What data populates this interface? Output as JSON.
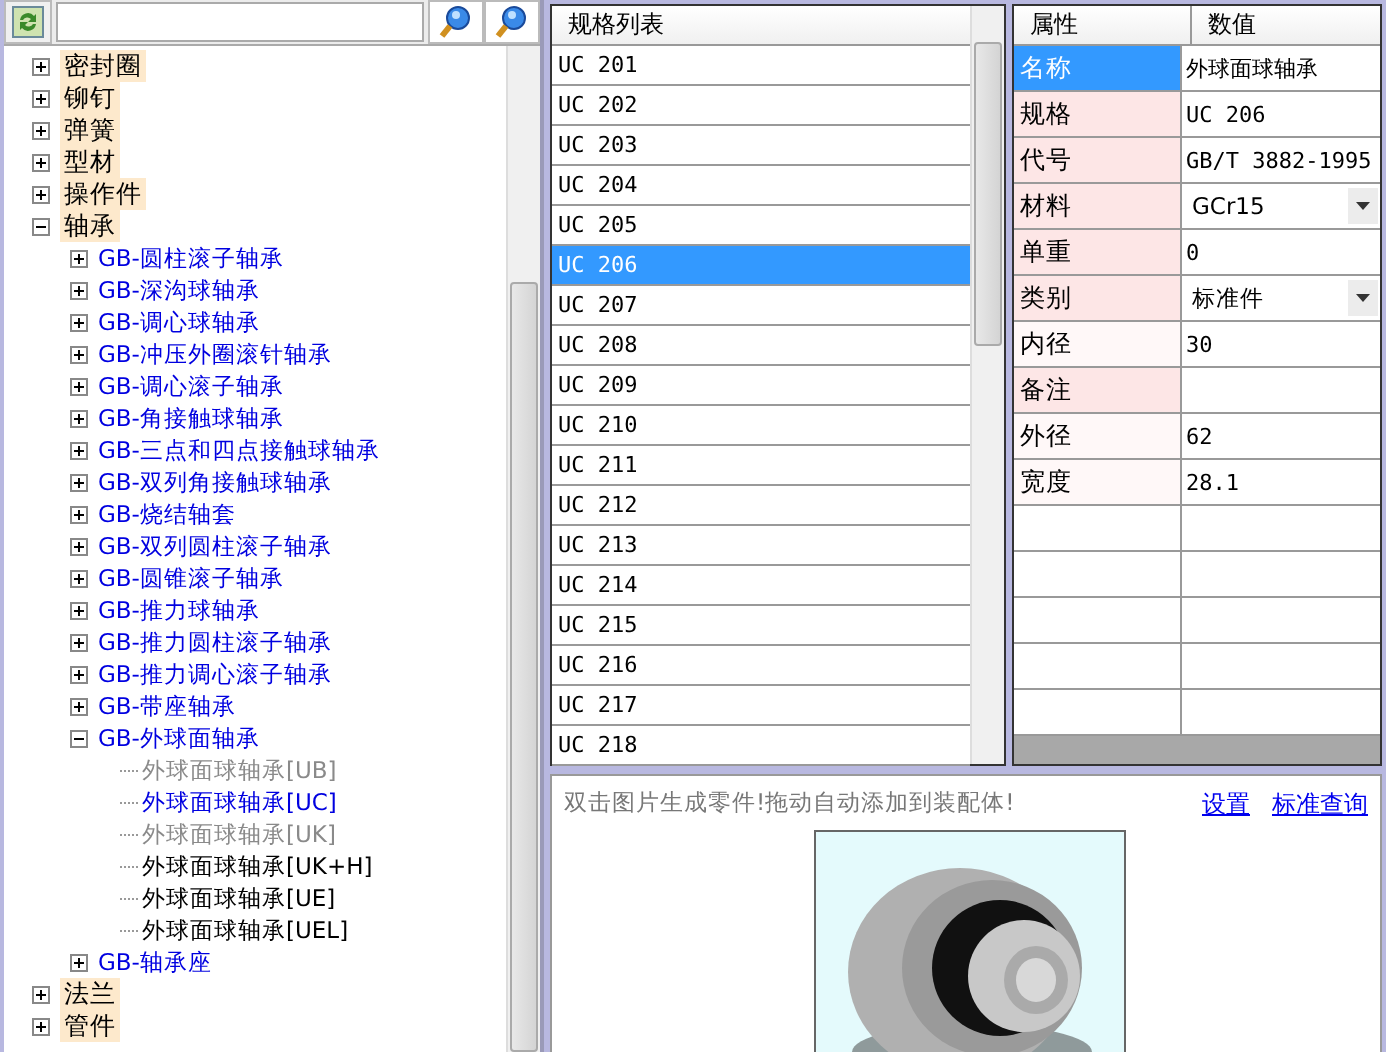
{
  "tree": [
    {
      "label": "密封圈",
      "expanded": false
    },
    {
      "label": "铆钉",
      "expanded": false
    },
    {
      "label": "弹簧",
      "expanded": false
    },
    {
      "label": "型材",
      "expanded": false
    },
    {
      "label": "操作件",
      "expanded": false
    },
    {
      "label": "轴承",
      "expanded": true,
      "children": [
        {
          "label": "GB-圆柱滚子轴承",
          "expanded": false
        },
        {
          "label": "GB-深沟球轴承",
          "expanded": false
        },
        {
          "label": "GB-调心球轴承",
          "expanded": false
        },
        {
          "label": "GB-冲压外圈滚针轴承",
          "expanded": false
        },
        {
          "label": "GB-调心滚子轴承",
          "expanded": false
        },
        {
          "label": "GB-角接触球轴承",
          "expanded": false
        },
        {
          "label": "GB-三点和四点接触球轴承",
          "expanded": false
        },
        {
          "label": "GB-双列角接触球轴承",
          "expanded": false
        },
        {
          "label": "GB-烧结轴套",
          "expanded": false
        },
        {
          "label": "GB-双列圆柱滚子轴承",
          "expanded": false
        },
        {
          "label": "GB-圆锥滚子轴承",
          "expanded": false
        },
        {
          "label": "GB-推力球轴承",
          "expanded": false
        },
        {
          "label": "GB-推力圆柱滚子轴承",
          "expanded": false
        },
        {
          "label": "GB-推力调心滚子轴承",
          "expanded": false
        },
        {
          "label": "GB-带座轴承",
          "expanded": false
        },
        {
          "label": "GB-外球面轴承",
          "expanded": true,
          "children": [
            {
              "label": "外球面球轴承[UB]",
              "disabled": true,
              "selected": false
            },
            {
              "label": "外球面球轴承[UC]",
              "disabled": false,
              "selected": true
            },
            {
              "label": "外球面球轴承[UK]",
              "disabled": true,
              "selected": false
            },
            {
              "label": "外球面球轴承[UK+H]",
              "disabled": false,
              "selected": false
            },
            {
              "label": "外球面球轴承[UE]",
              "disabled": false,
              "selected": false
            },
            {
              "label": "外球面球轴承[UEL]",
              "disabled": false,
              "selected": false
            }
          ]
        },
        {
          "label": "GB-轴承座",
          "expanded": false
        }
      ]
    },
    {
      "label": "法兰",
      "expanded": false
    },
    {
      "label": "管件",
      "expanded": false
    }
  ],
  "spec_list": {
    "header": "规格列表",
    "rows": [
      {
        "label": "UC 201",
        "selected": false
      },
      {
        "label": "UC 202",
        "selected": false
      },
      {
        "label": "UC 203",
        "selected": false
      },
      {
        "label": "UC 204",
        "selected": false
      },
      {
        "label": "UC 205",
        "selected": false
      },
      {
        "label": "UC 206",
        "selected": true
      },
      {
        "label": "UC 207",
        "selected": false
      },
      {
        "label": "UC 208",
        "selected": false
      },
      {
        "label": "UC 209",
        "selected": false
      },
      {
        "label": "UC 210",
        "selected": false
      },
      {
        "label": "UC 211",
        "selected": false
      },
      {
        "label": "UC 212",
        "selected": false
      },
      {
        "label": "UC 213",
        "selected": false
      },
      {
        "label": "UC 214",
        "selected": false
      },
      {
        "label": "UC 215",
        "selected": false
      },
      {
        "label": "UC 216",
        "selected": false
      },
      {
        "label": "UC 217",
        "selected": false
      },
      {
        "label": "UC 218",
        "selected": false
      }
    ]
  },
  "properties": {
    "columns": [
      "属性",
      "数值"
    ],
    "rows": [
      {
        "name": "名称",
        "value": "外球面球轴承",
        "kind": "text",
        "selected": true,
        "highlighted": true
      },
      {
        "name": "规格",
        "value": "UC 206",
        "kind": "text",
        "selected": false,
        "highlighted": true
      },
      {
        "name": "代号",
        "value": "GB/T 3882-1995",
        "kind": "text",
        "selected": false,
        "highlighted": true
      },
      {
        "name": "材料",
        "value": "GCr15",
        "kind": "dropdown",
        "selected": false,
        "highlighted": true
      },
      {
        "name": "单重",
        "value": "0",
        "kind": "text",
        "selected": false,
        "highlighted": true
      },
      {
        "name": "类别",
        "value": "标准件",
        "kind": "dropdown",
        "selected": false,
        "highlighted": true
      },
      {
        "name": "内径",
        "value": "30",
        "kind": "text",
        "selected": false,
        "highlighted": false
      },
      {
        "name": "备注",
        "kind": "text",
        "selected": false,
        "highlighted": true
      },
      {
        "name": "外径",
        "value": "62",
        "kind": "text",
        "selected": false,
        "highlighted": false
      },
      {
        "name": "宽度",
        "value": "28.1",
        "kind": "text",
        "selected": false,
        "highlighted": false
      }
    ]
  },
  "preview": {
    "hint": "双击图片生成零件!拖动自动添加到装配体!",
    "links": [
      "设置",
      "标准查询"
    ]
  }
}
